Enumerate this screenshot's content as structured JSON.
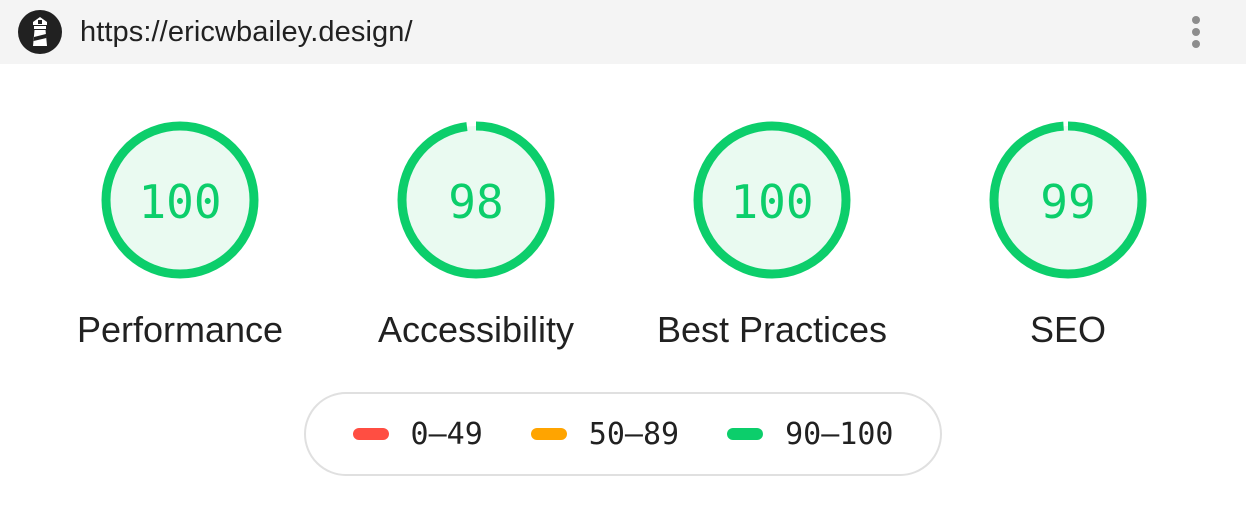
{
  "header": {
    "url": "https://ericwbailey.design/",
    "logo_icon": "lighthouse-icon",
    "menu_icon": "more-vertical-icon"
  },
  "gauges": [
    {
      "label": "Performance",
      "score": "100",
      "value": 100
    },
    {
      "label": "Accessibility",
      "score": "98",
      "value": 98
    },
    {
      "label": "Best Practices",
      "score": "100",
      "value": 100
    },
    {
      "label": "SEO",
      "score": "99",
      "value": 99
    }
  ],
  "colors": {
    "pass": "#0cce6b",
    "pass_bg": "#eafaf1",
    "average": "#ffa400",
    "fail": "#ff4e42"
  },
  "legend": [
    {
      "range": "0–49",
      "color": "#ff4e42"
    },
    {
      "range": "50–89",
      "color": "#ffa400"
    },
    {
      "range": "90–100",
      "color": "#0cce6b"
    }
  ]
}
